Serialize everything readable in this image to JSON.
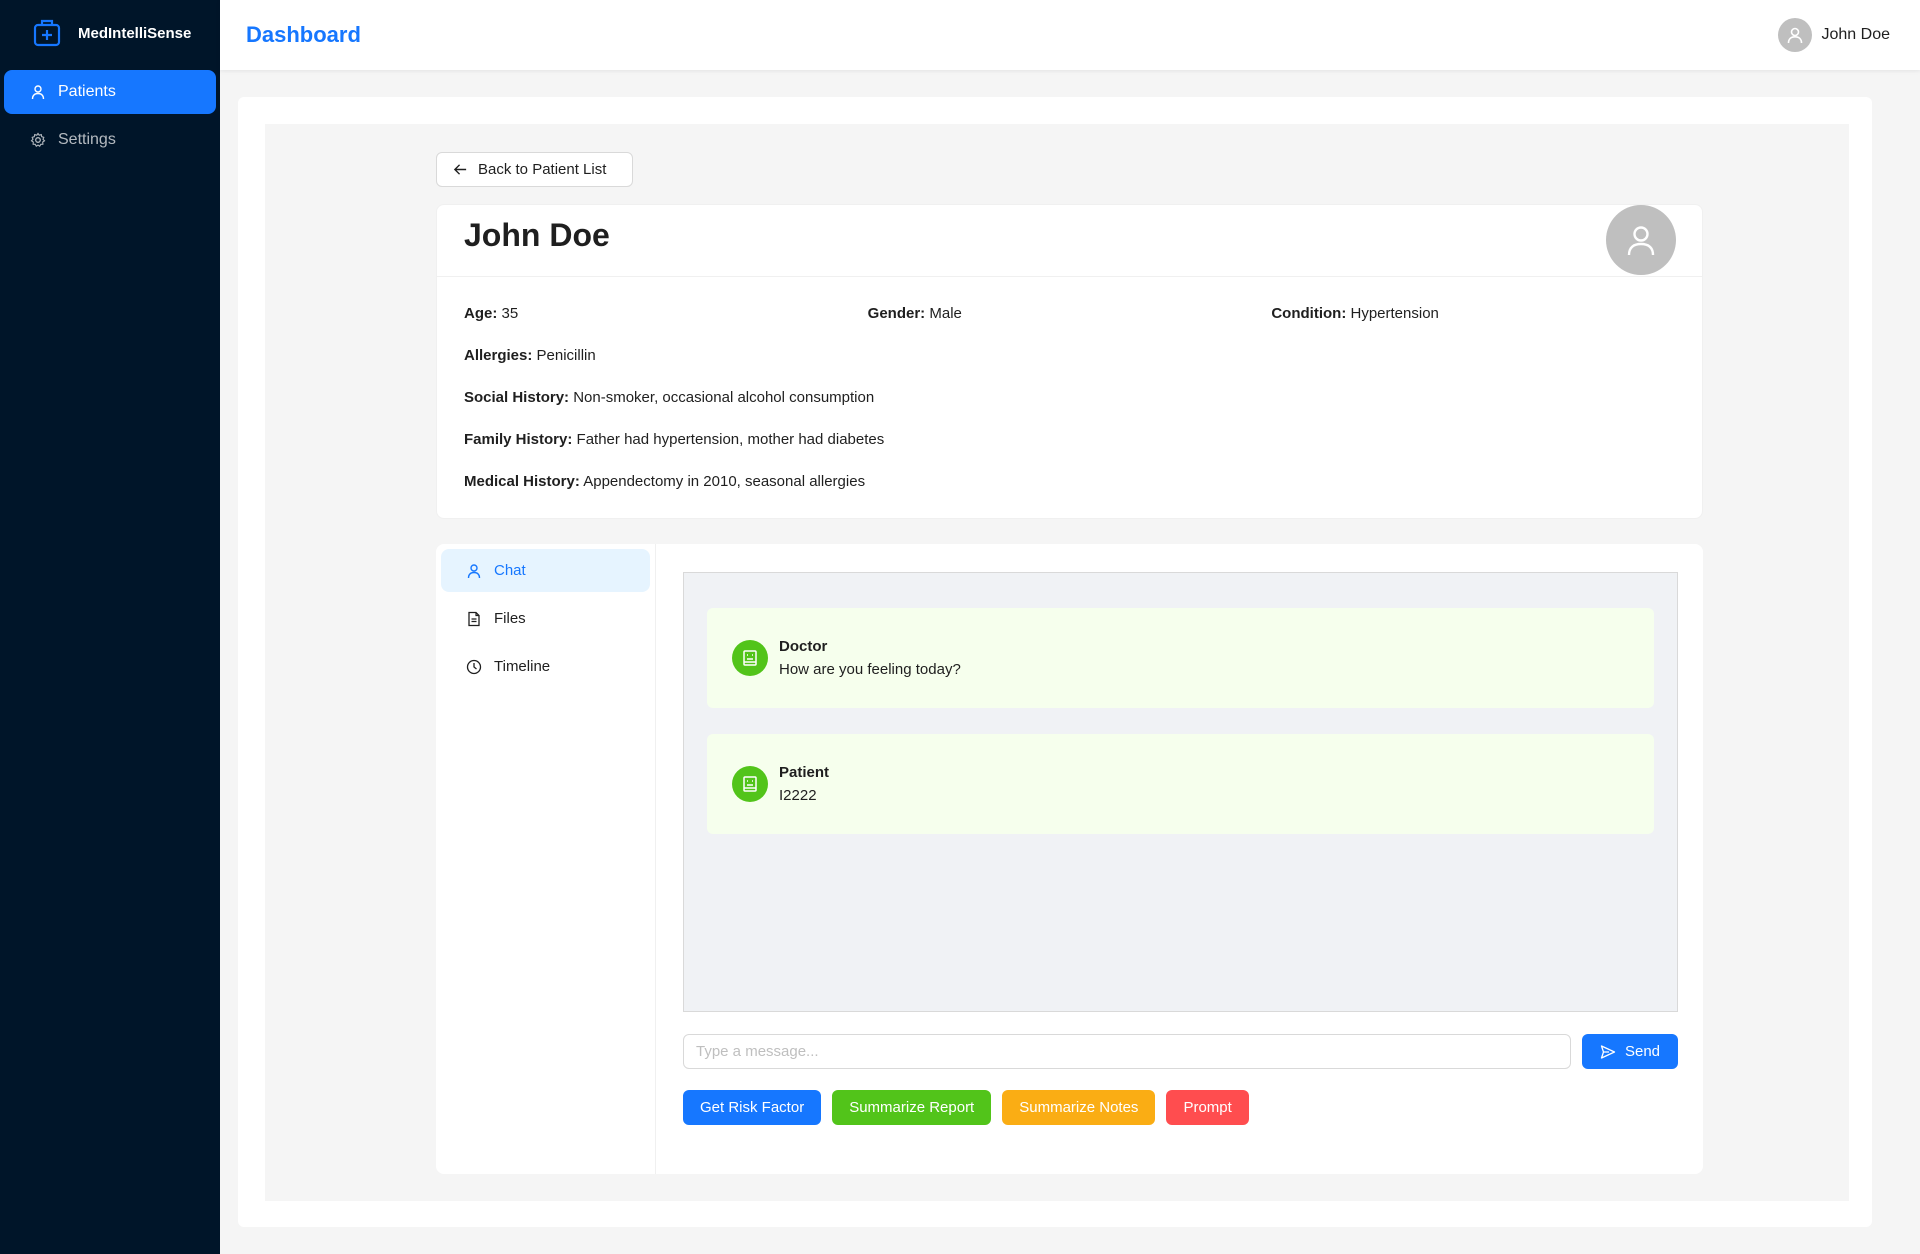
{
  "app": {
    "name": "MedIntelliSense",
    "brand_color": "#1677ff"
  },
  "sidebar": {
    "items": [
      {
        "label": "Patients",
        "icon": "user-icon",
        "active": true
      },
      {
        "label": "Settings",
        "icon": "gear-icon",
        "active": false
      }
    ]
  },
  "header": {
    "title": "Dashboard",
    "user_name": "John Doe"
  },
  "back_button": {
    "label": "Back to Patient List"
  },
  "patient": {
    "name": "John Doe",
    "age_label": "Age:",
    "age": "35",
    "gender_label": "Gender:",
    "gender": "Male",
    "condition_label": "Condition:",
    "condition": "Hypertension",
    "allergies_label": "Allergies:",
    "allergies": "Penicillin",
    "social_label": "Social History:",
    "social": "Non-smoker, occasional alcohol consumption",
    "family_label": "Family History:",
    "family": "Father had hypertension, mother had diabetes",
    "medical_label": "Medical History:",
    "medical": "Appendectomy in 2010, seasonal allergies"
  },
  "tabs": [
    {
      "label": "Chat",
      "icon": "user-icon",
      "active": true
    },
    {
      "label": "Files",
      "icon": "file-icon",
      "active": false
    },
    {
      "label": "Timeline",
      "icon": "clock-icon",
      "active": false
    }
  ],
  "chat": {
    "messages": [
      {
        "sender": "Doctor",
        "text": "How are you feeling today?"
      },
      {
        "sender": "Patient",
        "text": "I2222"
      }
    ],
    "input_placeholder": "Type a message...",
    "send_label": "Send"
  },
  "actions": [
    {
      "label": "Get Risk Factor",
      "color": "#1677ff"
    },
    {
      "label": "Summarize Report",
      "color": "#52c41a"
    },
    {
      "label": "Summarize Notes",
      "color": "#faad14"
    },
    {
      "label": "Prompt",
      "color": "#ff4d4f"
    }
  ]
}
